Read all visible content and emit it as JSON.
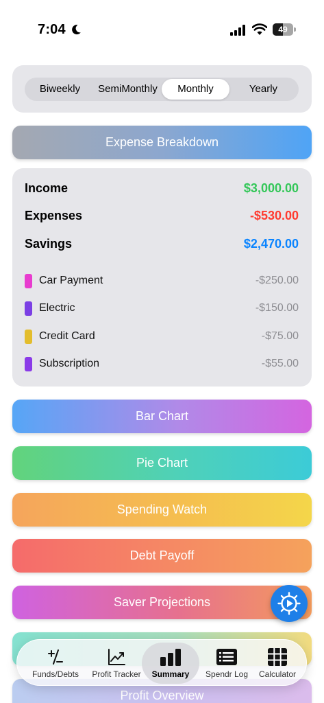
{
  "status": {
    "time": "7:04",
    "battery": "49",
    "battery_level": 0.49
  },
  "period": {
    "options": [
      "Biweekly",
      "SemiMonthly",
      "Monthly",
      "Yearly"
    ],
    "selected": "Monthly"
  },
  "header_button": "Expense Breakdown",
  "summary": {
    "income": {
      "label": "Income",
      "value": "$3,000.00"
    },
    "expenses": {
      "label": "Expenses",
      "value": "-$530.00"
    },
    "savings": {
      "label": "Savings",
      "value": "$2,470.00"
    },
    "items": [
      {
        "name": "Car Payment",
        "amount": "-$250.00",
        "color": "#e83ccf"
      },
      {
        "name": "Electric",
        "amount": "-$150.00",
        "color": "#7b3fe4"
      },
      {
        "name": "Credit Card",
        "amount": "-$75.00",
        "color": "#e3bd2d"
      },
      {
        "name": "Subscription",
        "amount": "-$55.00",
        "color": "#8a3be8"
      }
    ]
  },
  "actions": {
    "bar_chart": "Bar Chart",
    "pie_chart": "Pie Chart",
    "spending_watch": "Spending Watch",
    "debt_payoff": "Debt Payoff",
    "saver_projections": "Saver Projections",
    "profit_overview": "Profit Overview"
  },
  "colors": {
    "income": "#34c759",
    "expense": "#ff3b30",
    "savings": "#0a84ff",
    "fab": "#1e7fe8"
  },
  "fab_icon": "gear-play-icon",
  "tabs": [
    {
      "label": "Funds/Debts",
      "icon": "plus-minus-icon"
    },
    {
      "label": "Profit Tracker",
      "icon": "line-chart-icon"
    },
    {
      "label": "Summary",
      "icon": "bar-chart-icon",
      "active": true
    },
    {
      "label": "Spendr Log",
      "icon": "list-icon"
    },
    {
      "label": "Calculator",
      "icon": "grid-icon"
    }
  ]
}
